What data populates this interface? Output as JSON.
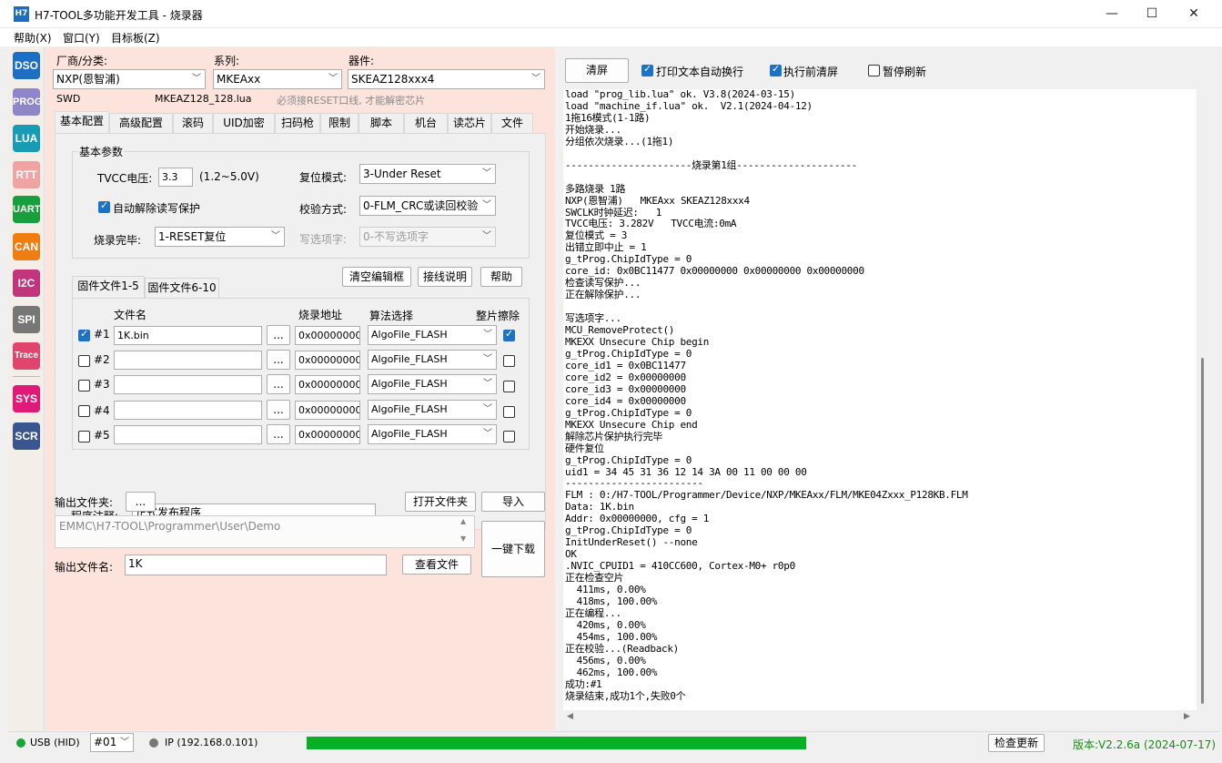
{
  "window": {
    "app_icon": "H7",
    "title": "H7-TOOL多功能开发工具 - 烧录器",
    "minimize": "—",
    "maximize": "☐",
    "close": "✕"
  },
  "menu": [
    "帮助(X)",
    "窗口(Y)",
    "目标板(Z)"
  ],
  "sidebar": [
    "DSO",
    "PROG",
    "LUA",
    "RTT",
    "UART",
    "CAN",
    "I2C",
    "SPI",
    "Trace",
    "SYS",
    "SCR"
  ],
  "sidebar_colors": [
    "#1d6fc4",
    "#8f86c9",
    "#1a9bb5",
    "#f0a3a3",
    "#189e3c",
    "#f07d0f",
    "#c2357d",
    "#777777",
    "#e0456d",
    "#e01a78",
    "#3a5590"
  ],
  "device": {
    "vendor_label": "厂商/分类:",
    "vendor_value": "NXP(恩智浦)",
    "series_label": "系列:",
    "series_value": "MKEAxx",
    "chip_label": "器件:",
    "chip_value": "SKEAZ128xxx4",
    "interface": "SWD",
    "lua_file": "MKEAZ128_128.lua",
    "hint": "必须接RESET口线, 才能解密芯片"
  },
  "tabs": [
    "基本配置",
    "高级配置",
    "滚码",
    "UID加密",
    "扫码枪",
    "限制",
    "脚本",
    "机台",
    "读芯片",
    "文件"
  ],
  "basic": {
    "group_title": "基本参数",
    "tvcc_label": "TVCC电压:",
    "tvcc_value": "3.3",
    "tvcc_range": "(1.2~5.0V)",
    "reset_label": "复位模式:",
    "reset_value": "3-Under Reset",
    "auto_unprotect_label": "自动解除读写保护",
    "verify_label": "校验方式:",
    "verify_value": "0-FLM_CRC或读回校验",
    "finish_label": "烧录完毕:",
    "finish_value": "1-RESET复位",
    "option_label": "写选项字:",
    "option_value": "0-不写选项字"
  },
  "file_section": {
    "clear_button": "清空编辑框",
    "wiring_button": "接线说明",
    "help_button": "帮助",
    "subtabs": [
      "固件文件1-5",
      "固件文件6-10"
    ],
    "col_filename": "文件名",
    "col_address": "烧录地址",
    "col_algo": "算法选择",
    "col_erase": "整片擦除",
    "browse": "...",
    "rows": [
      {
        "label": "#1",
        "checked": true,
        "file": "1K.bin",
        "addr": "0x00000000",
        "algo": "AlgoFile_FLASH",
        "erase": true
      },
      {
        "label": "#2",
        "checked": false,
        "file": "",
        "addr": "0x00000000",
        "algo": "AlgoFile_FLASH",
        "erase": false
      },
      {
        "label": "#3",
        "checked": false,
        "file": "",
        "addr": "0x00000000",
        "algo": "AlgoFile_FLASH",
        "erase": false
      },
      {
        "label": "#4",
        "checked": false,
        "file": "",
        "addr": "0x00000000",
        "algo": "AlgoFile_FLASH",
        "erase": false
      },
      {
        "label": "#5",
        "checked": false,
        "file": "",
        "addr": "0x00000000",
        "algo": "AlgoFile_FLASH",
        "erase": false
      }
    ],
    "comment_label": "程序注释:",
    "comment_value": "正式发布程序"
  },
  "output": {
    "folder_label": "输出文件夹:",
    "folder_browse": "...",
    "open_folder_button": "打开文件夹",
    "import_button": "导入",
    "path": "EMMC\\H7-TOOL\\Programmer\\User\\Demo",
    "one_key_button": "一键下载",
    "name_label": "输出文件名:",
    "name_value": "1K",
    "view_button": "查看文件"
  },
  "log_toolbar": {
    "clear_button": "清屏",
    "wrap_label": "打印文本自动换行",
    "clear_before_label": "执行前清屏",
    "pause_label": "暂停刷新",
    "wrap": true,
    "clear_before": true,
    "pause": false
  },
  "log_lines": [
    "load \"prog_lib.lua\" ok. V3.8(2024-03-15)",
    "load \"machine_if.lua\" ok.  V2.1(2024-04-12)",
    "1拖16模式(1-1路)",
    "开始烧录...",
    "分组依次烧录...(1拖1)",
    "",
    "----------------------烧录第1组---------------------",
    "",
    "多路烧录 1路",
    "NXP(恩智浦)   MKEAxx SKEAZ128xxx4",
    "SWCLK时钟延迟:   1",
    "TVCC电压: 3.282V   TVCC电流:0mA",
    "复位模式 = 3",
    "出错立即中止 = 1",
    "g_tProg.ChipIdType = 0",
    "core_id: 0x0BC11477 0x00000000 0x00000000 0x00000000",
    "检查读写保护...",
    "正在解除保护...",
    "",
    "写选项字...",
    "MCU_RemoveProtect()",
    "MKEXX Unsecure Chip begin",
    "g_tProg.ChipIdType = 0",
    "core_id1 = 0x0BC11477",
    "core_id2 = 0x00000000",
    "core_id3 = 0x00000000",
    "core_id4 = 0x00000000",
    "g_tProg.ChipIdType = 0",
    "MKEXX Unsecure Chip end",
    "解除芯片保护执行完毕",
    "硬件复位",
    "g_tProg.ChipIdType = 0",
    "uid1 = 34 45 31 36 12 14 3A 00 11 00 00 00",
    "------------------------",
    "FLM : 0:/H7-TOOL/Programmer/Device/NXP/MKEAxx/FLM/MKE04Zxxx_P128KB.FLM",
    "Data: 1K.bin",
    "Addr: 0x00000000, cfg = 1",
    "g_tProg.ChipIdType = 0",
    "InitUnderReset() --none",
    "OK",
    ".NVIC_CPUID1 = 410CC600, Cortex-M0+ r0p0",
    "正在检查空片",
    "  411ms, 0.00%",
    "  418ms, 100.00%",
    "正在编程...",
    "  420ms, 0.00%",
    "  454ms, 100.00%",
    "正在校验...(Readback)",
    "  456ms, 0.00%",
    "  462ms, 100.00%",
    "成功:#1",
    "烧录结束,成功1个,失败0个"
  ],
  "status": {
    "usb_label": "USB (HID)",
    "port_value": "#01",
    "ip_label": "IP (192.168.0.101)",
    "progress_percent": 100,
    "progress_color": "#06b025",
    "update_button": "检查更新",
    "version": "版本:V2.2.6a (2024-07-17)",
    "version_color": "#1a8a1a"
  }
}
